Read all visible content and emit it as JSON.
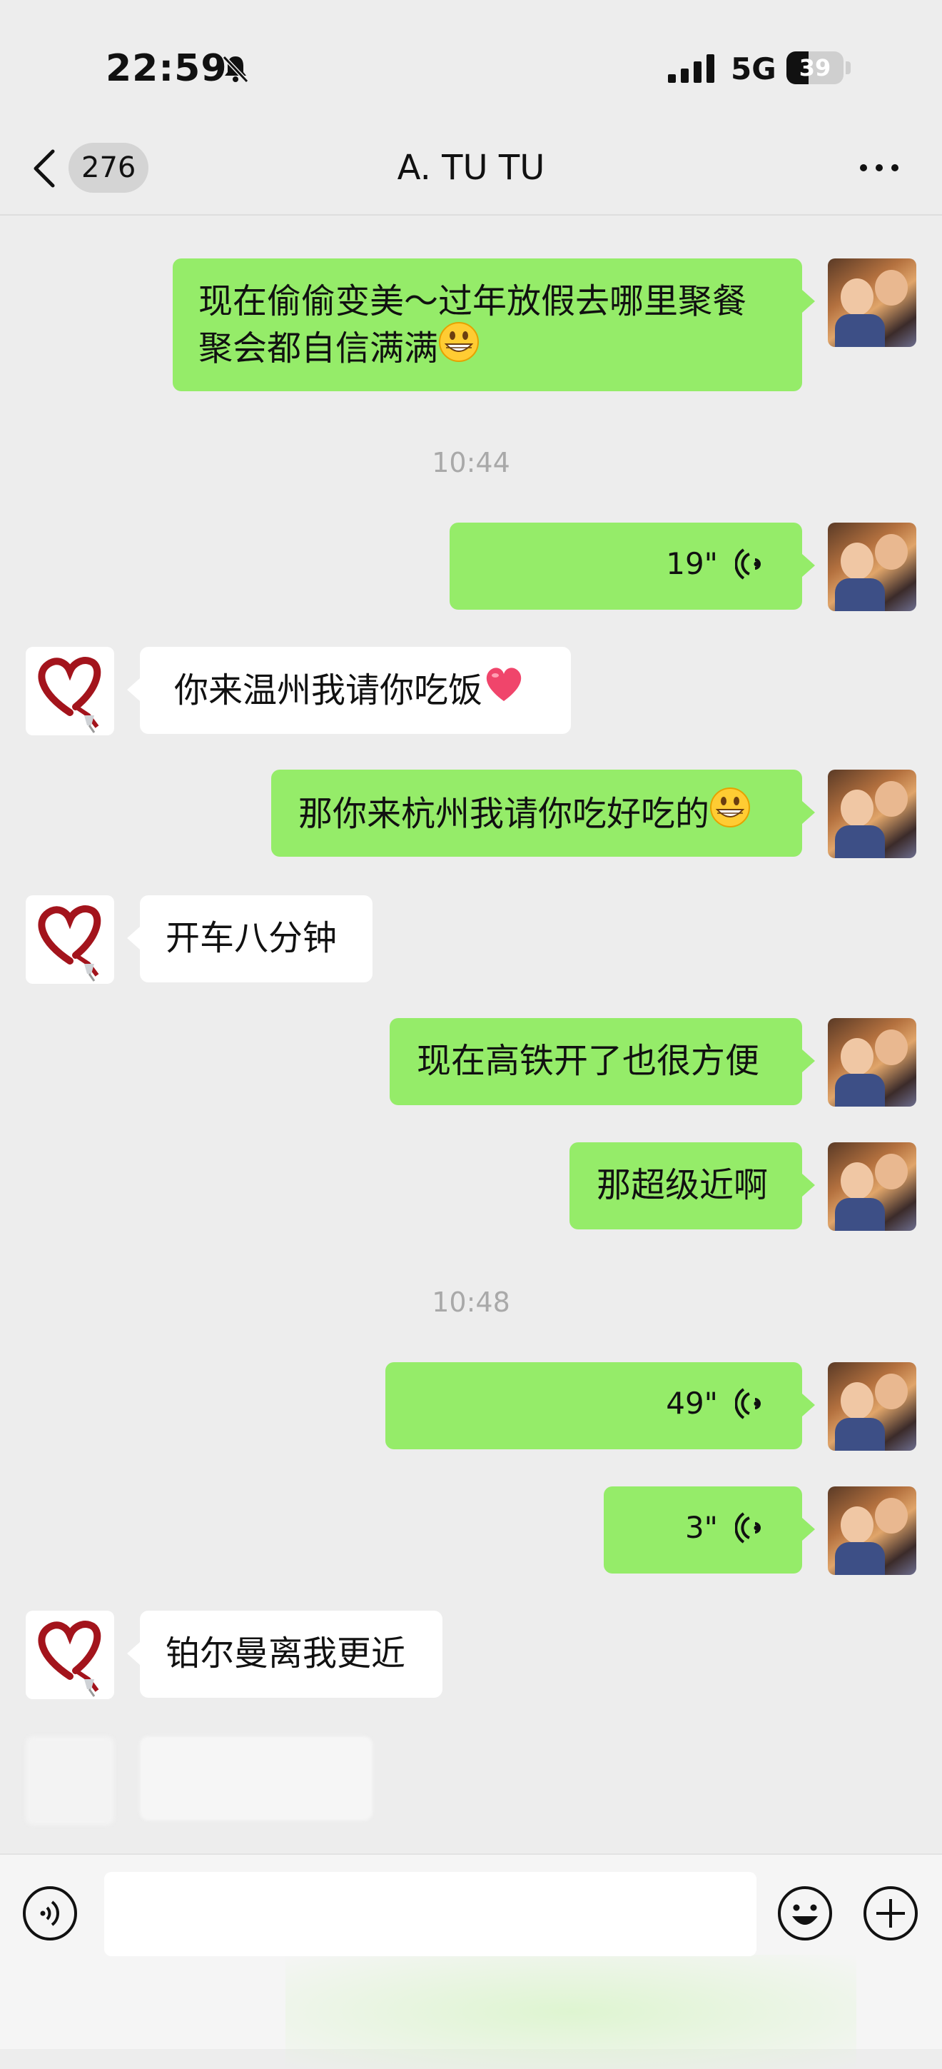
{
  "status_bar": {
    "time": "22:59",
    "network": "5G",
    "battery_level": "39"
  },
  "nav": {
    "unread_count": "276",
    "title": "A.   TU TU"
  },
  "messages": [
    {
      "sender": "me",
      "type": "text",
      "text": "现在偷偷变美～过年放假去哪里聚餐\n聚会都自信满满",
      "emoji": "grinning-face"
    },
    {
      "type": "timestamp",
      "text": "10:44"
    },
    {
      "sender": "me",
      "type": "voice",
      "duration": "19\""
    },
    {
      "sender": "them",
      "type": "text",
      "text": "你来温州我请你吃饭",
      "emoji": "red-heart"
    },
    {
      "sender": "me",
      "type": "text",
      "text": "那你来杭州我请你吃好吃的",
      "emoji": "grinning-face"
    },
    {
      "sender": "them",
      "type": "text",
      "text": "开车八分钟"
    },
    {
      "sender": "me",
      "type": "text",
      "text": "现在高铁开了也很方便"
    },
    {
      "sender": "me",
      "type": "text",
      "text": "那超级近啊"
    },
    {
      "type": "timestamp",
      "text": "10:48"
    },
    {
      "sender": "me",
      "type": "voice",
      "duration": "49\""
    },
    {
      "sender": "me",
      "type": "voice",
      "duration": "3\""
    },
    {
      "sender": "them",
      "type": "text",
      "text": "铂尔曼离我更近"
    }
  ],
  "colors": {
    "my_bubble": "#95ec69",
    "their_bubble": "#ffffff",
    "background": "#ededed"
  }
}
